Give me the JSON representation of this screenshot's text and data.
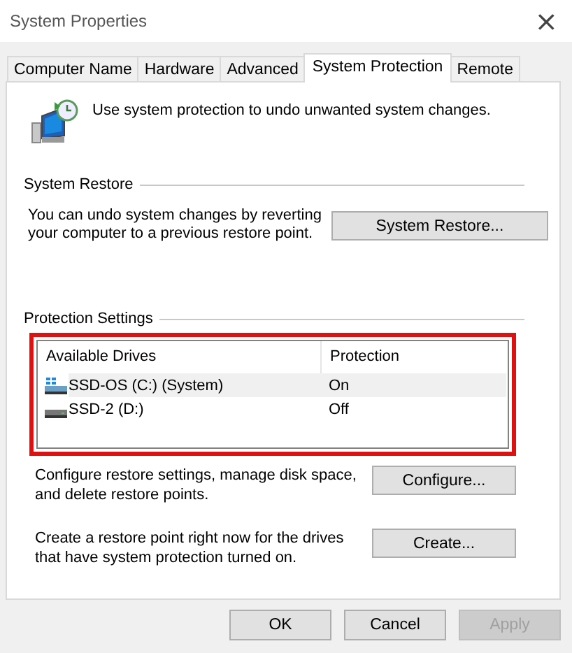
{
  "window": {
    "title": "System Properties",
    "close": "×"
  },
  "tabs": [
    {
      "label": "Computer Name",
      "selected": false
    },
    {
      "label": "Hardware",
      "selected": false
    },
    {
      "label": "Advanced",
      "selected": false
    },
    {
      "label": "System Protection",
      "selected": true
    },
    {
      "label": "Remote",
      "selected": false
    }
  ],
  "intro": "Use system protection to undo unwanted system changes.",
  "system_restore": {
    "title": "System Restore",
    "text": "You can undo system changes by reverting your computer to a previous restore point.",
    "button": "System Restore..."
  },
  "protection_settings": {
    "title": "Protection Settings",
    "highlighted": true,
    "columns": [
      "Available Drives",
      "Protection"
    ],
    "drives": [
      {
        "kind": "system",
        "name": "SSD-OS (C:) (System)",
        "protection": "On",
        "selected": true
      },
      {
        "kind": "drive",
        "name": "SSD-2 (D:)",
        "protection": "Off",
        "selected": false
      }
    ],
    "actions": [
      {
        "text": "Configure restore settings, manage disk space, and delete restore points.",
        "button": "Configure..."
      },
      {
        "text": "Create a restore point right now for the drives that have system protection turned on.",
        "button": "Create..."
      }
    ]
  },
  "buttons": [
    {
      "label": "OK",
      "disabled": false
    },
    {
      "label": "Cancel",
      "disabled": false
    },
    {
      "label": "Apply",
      "disabled": true
    }
  ]
}
